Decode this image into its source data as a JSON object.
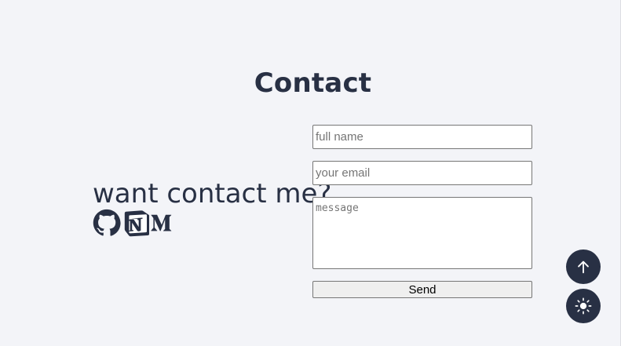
{
  "contact": {
    "title": "Contact",
    "tagline": "want contact me?",
    "socials": [
      {
        "name": "github",
        "icon": "github-icon"
      },
      {
        "name": "notion",
        "icon": "notion-icon"
      },
      {
        "name": "medium",
        "icon": "medium-icon"
      }
    ]
  },
  "form": {
    "name_placeholder": "full name",
    "email_placeholder": "your email",
    "message_placeholder": "message",
    "send_label": "Send"
  },
  "floating": {
    "scroll_top_icon": "arrow-up-icon",
    "theme_toggle_icon": "sun-icon"
  },
  "colors": {
    "background": "#f3f4f8",
    "text": "#283044",
    "fab": "#283044"
  }
}
